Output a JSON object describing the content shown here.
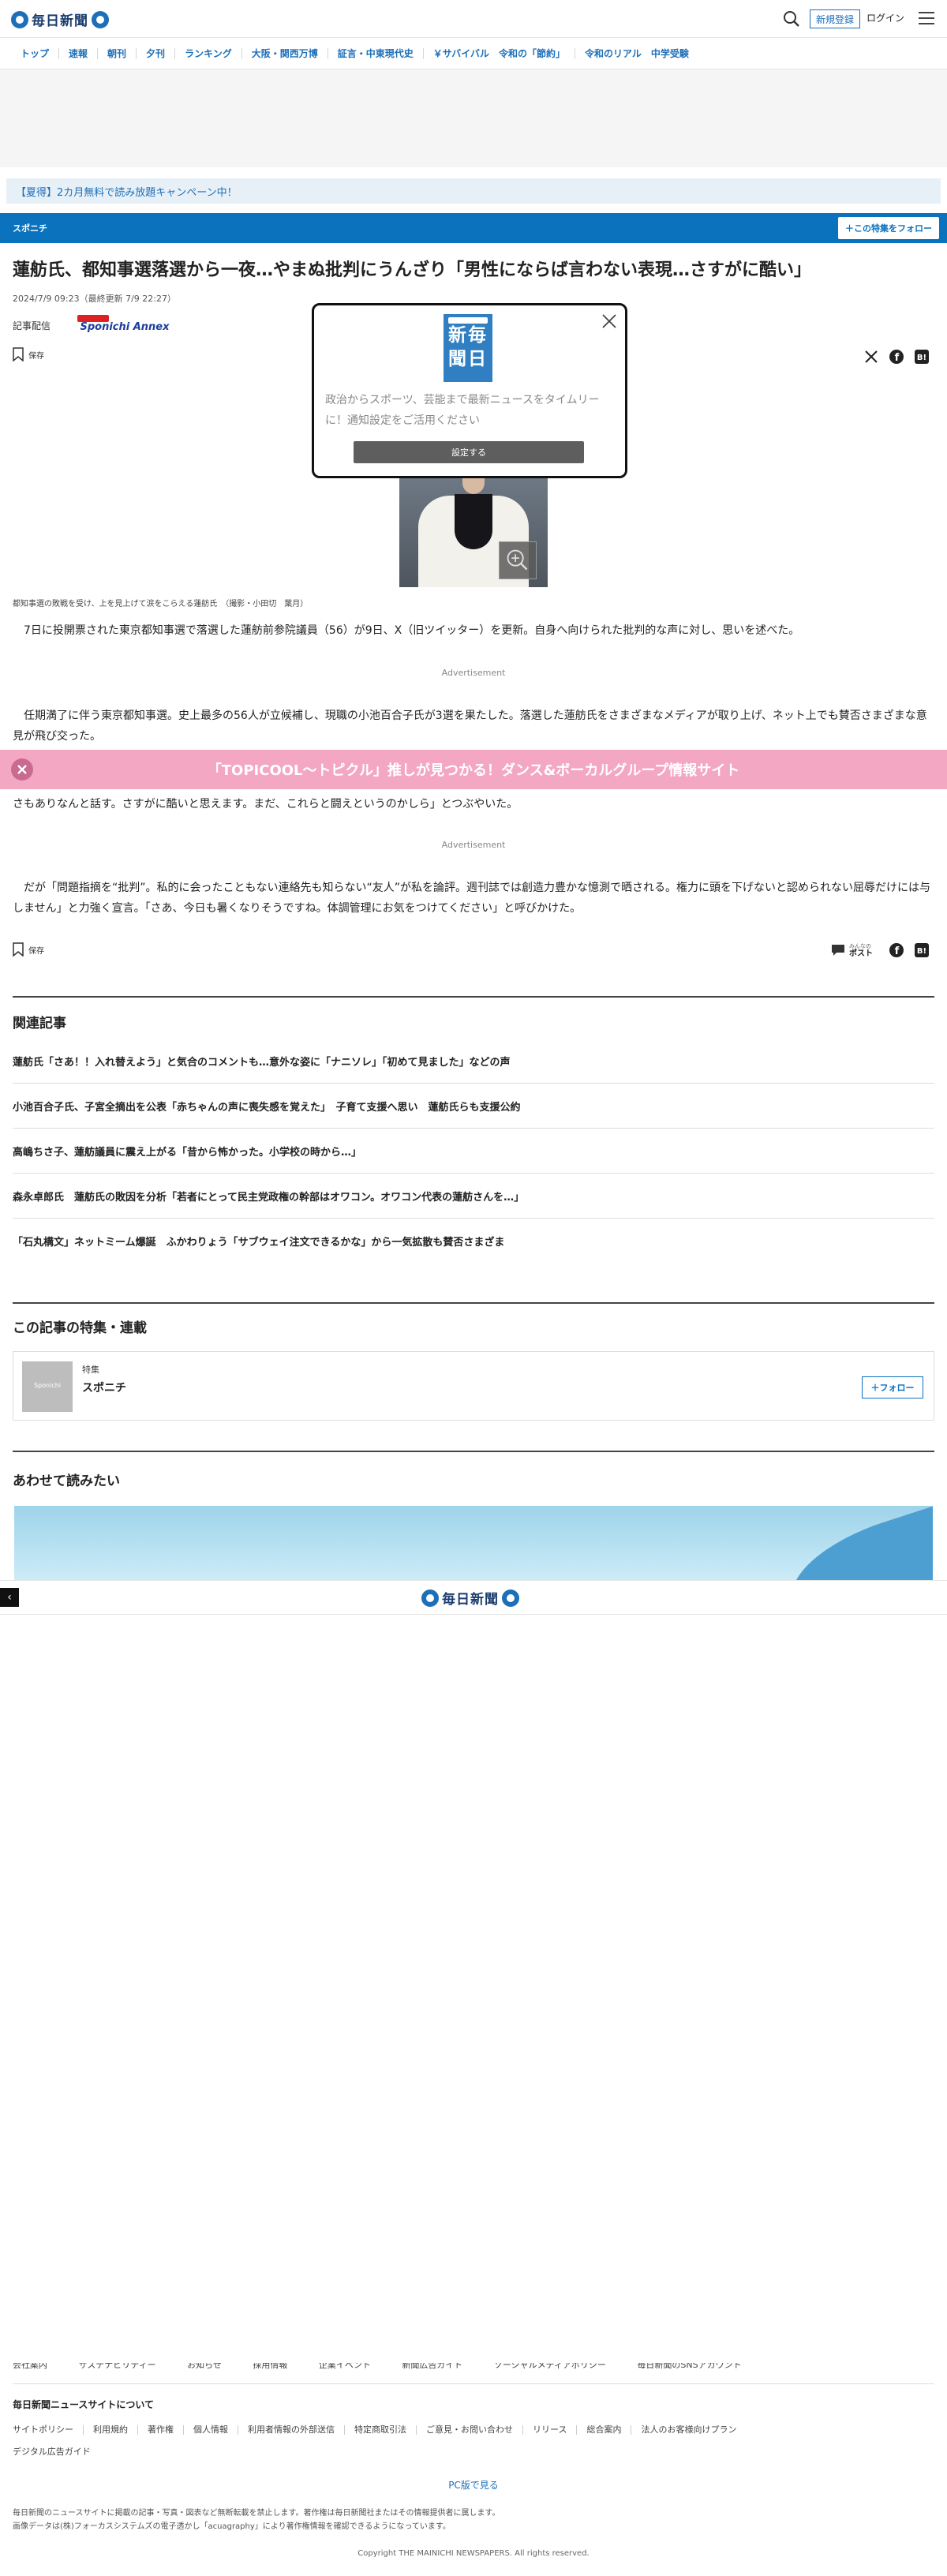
{
  "header": {
    "logo_text": "毎日新聞",
    "register_label": "新規登録",
    "login_label": "ログイン"
  },
  "nav": {
    "items": [
      "トップ",
      "速報",
      "朝刊",
      "夕刊",
      "ランキング",
      "大阪・関西万博",
      "証言・中東現代史",
      "￥サバイバル　令和の「節約」",
      "令和のリアル　中学受験"
    ]
  },
  "campaign": {
    "text": "【夏得】2カ月無料で読み放題キャンペーン中！"
  },
  "series": {
    "label": "スポニチ",
    "follow_label": "＋この特集をフォロー"
  },
  "article": {
    "headline": "蓮舫氏、都知事選落選から一夜…やまぬ批判にうんざり「男性にならば言わない表現…さすがに酷い」",
    "datetime": "2024/7/9 09:23（最終更新 7/9 22:27）",
    "source_label": "記事配信",
    "source_logo_text": "Sponichi Annex",
    "save_label": "保存",
    "caption": "都知事選の敗戦を受け、上を見上げて涙をこらえる蓮舫氏　（撮影・小田切　葉月）",
    "paragraph_1": "7日に投開票された東京都知事選で落選した蓮舫前参院議員（56）が9日、X（旧ツイッター）を更新。自身へ向けられた批判的な声に対し、思いを述べた。",
    "advertisement_label": "Advertisement",
    "paragraph_2": "任期満了に伴う東京都知事選。史上最多の56人が立候補し、現職の小池百合子氏が3選を果たした。落選した蓮舫氏をさまざまなメディアが取り上げ、ネット上でも賛否さまざまな意見が飛び交った。",
    "paragraph_3": "さもありなんと話す。さすがに酷いと思えます。まだ、これらと闘えというのかしら」とつぶやいた。",
    "advertisement_label_2": "Advertisement",
    "paragraph_4": "だが「問題指摘を“批判”。私的に会ったこともない連絡先も知らない“友人”が私を論評。週刊誌では創造力豊かな憶測で晒される。権力に頭を下げないと認められない屈辱だけには与しません」と力強く宣言。「さあ、今日も暑くなりそうですね。体調管理にお気をつけてください」と呼びかけた。",
    "post_label_small": "みんなの",
    "post_label": "ポスト"
  },
  "pink_banner": {
    "text": "「TOPICOOL～トピクル」推しが見つかる！ダンス&ボーカルグループ情報サイト"
  },
  "related": {
    "title": "関連記事",
    "items": [
      "蓮舫氏「さあ！！入れ替えよう」と気合のコメントも…意外な姿に「ナニソレ」「初めて見ました」などの声",
      "小池百合子氏、子宮全摘出を公表「赤ちゃんの声に喪失感を覚えた」　子育て支援へ思い　蓮舫氏らも支援公約",
      "高嶋ちさ子、蓮舫議員に震え上がる「昔から怖かった。小学校の時から…」",
      "森永卓郎氏　蓮舫氏の敗因を分析「若者にとって民主党政権の幹部はオワコン。オワコン代表の蓮舫さんを…」",
      "「石丸構文」ネットミーム爆誕　ふかわりょう「サブウェイ注文できるかな」から一気拡散も賛否さまざま"
    ]
  },
  "feature": {
    "title": "この記事の特集・連載",
    "kind": "特集",
    "thumb_text": "Sponichi",
    "name": "スポニチ",
    "follow_label": "＋フォロー"
  },
  "read_together": {
    "title": "あわせて読みたい"
  },
  "bottom_bar": {
    "logo_text": "毎日新聞"
  },
  "footer": {
    "cut_row": [
      "会社案内",
      "サステナビリティー",
      "お知らせ",
      "採用情報",
      "企業イベント",
      "新聞広告ガイド",
      "ソーシャルメディアポリシー",
      "毎日新聞のSNSアカウント"
    ],
    "section_title": "毎日新聞ニュースサイトについて",
    "links_row_1": [
      "サイトポリシー",
      "利用規約",
      "著作権",
      "個人情報",
      "利用者情報の外部送信",
      "特定商取引法",
      "ご意見・お問い合わせ",
      "リリース",
      "総合案内",
      "法人のお客様向けプラン"
    ],
    "links_row_2": [
      "デジタル広告ガイド"
    ],
    "pc_link": "PC版で見る",
    "notice_1": "毎日新聞のニュースサイトに掲載の記事・写真・図表など無断転載を禁止します。著作権は毎日新聞社またはその情報提供者に属します。",
    "notice_2": "画像データは(株)フォーカスシステムズの電子透かし「acuagraphy」により著作権情報を確認できるようになっています。",
    "copyright": "Copyright THE MAINICHI NEWSPAPERS. All rights reserved."
  },
  "modal": {
    "logo_chars": [
      "新",
      "毎",
      "聞",
      "日"
    ],
    "text": "政治からスポーツ、芸能まで最新ニュースをタイムリーに！通知設定をご活用ください",
    "button_label": "設定する"
  }
}
